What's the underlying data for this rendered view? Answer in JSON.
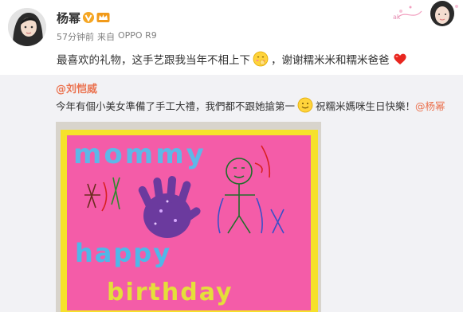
{
  "post": {
    "author": "杨幂",
    "time": "57分钟前",
    "source_prefix": "来自",
    "source": "OPPO R9",
    "text_part1": "最喜欢的礼物，这手艺跟我当年不相上下",
    "text_part2": "，谢谢糯米米和糯米爸爸",
    "icons": {
      "verified": "verified-v-icon",
      "vip": "vip-crown-icon",
      "emoji1": "shy-hand-emoji",
      "emoji2": "red-heart-emoji"
    }
  },
  "repost": {
    "author": "@刘恺威",
    "text_part1": "今年有個小美女準備了手工大禮，我們都不跟她搶第一",
    "text_part2": "祝糯米媽咪生日快樂！",
    "mention": "@杨幂",
    "photo": {
      "line1": "mommy",
      "line2": "happy",
      "line3": "birthday"
    }
  },
  "colors": {
    "mention": "#eb7350",
    "repost_bg": "#f2f2f5",
    "card_pink": "#f25aa4",
    "card_border": "#f7e12a"
  }
}
